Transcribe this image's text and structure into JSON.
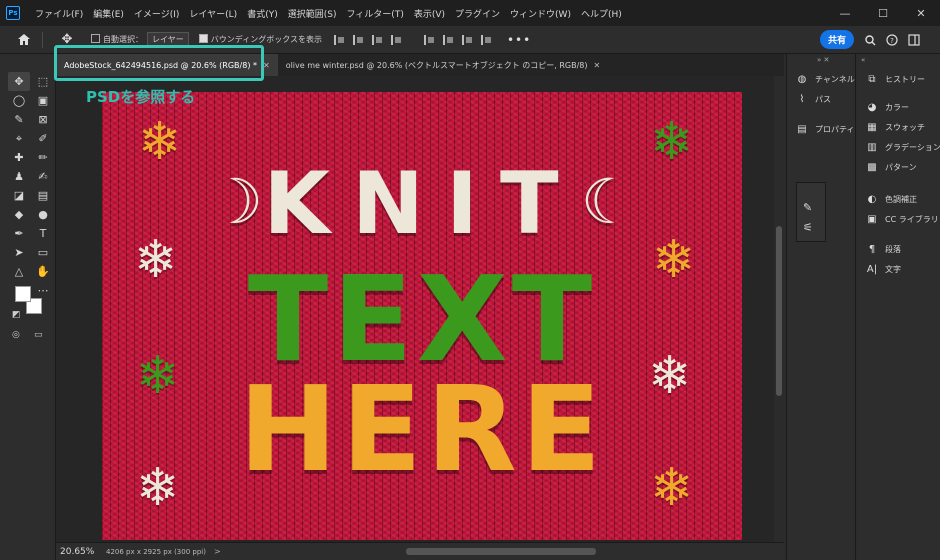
{
  "app": {
    "logo": "Ps"
  },
  "menu": {
    "items": [
      "ファイル(F)",
      "編集(E)",
      "イメージ(I)",
      "レイヤー(L)",
      "書式(Y)",
      "選択範囲(S)",
      "フィルター(T)",
      "表示(V)",
      "プラグイン",
      "ウィンドウ(W)",
      "ヘルプ(H)"
    ]
  },
  "window_controls": {
    "minimize": "—",
    "maximize": "☐",
    "close": "✕"
  },
  "options": {
    "auto_select": "自動選択：",
    "layer_dropdown": "レイヤー",
    "bounding_box": "バウンディングボックスを表示",
    "more": "•••",
    "share": "共有"
  },
  "tabs": [
    {
      "label": "AdobeStock_642494516.psd @ 20.6% (RGB/8) *",
      "close": "✕"
    },
    {
      "label": "olive me winter.psd @ 20.6% (ベクトルスマートオブジェクト のコピー, RGB/8)",
      "close": "✕"
    }
  ],
  "callout": "PSDを参照する",
  "canvas": {
    "line1": "KNIT",
    "line2": "TEXT",
    "line3": "HERE",
    "moon_left": "☽",
    "moon_right": "☾",
    "snowflake": "❄"
  },
  "status": {
    "zoom": "20.65%",
    "doc_info": "4206 px x 2925 px (300 ppi)",
    "arrow": ">"
  },
  "panels_left": {
    "channels": "チャンネル",
    "paths": "パス",
    "properties": "プロパティ",
    "collapse": "» ✕"
  },
  "panels_right": {
    "history": "ヒストリー",
    "color": "カラー",
    "swatches": "スウォッチ",
    "gradients": "グラデーション",
    "patterns": "パターン",
    "adjustments": "色調補正",
    "libraries": "CC ライブラリ",
    "paragraph": "段落",
    "character": "文字",
    "collapse": "«"
  },
  "colors": {
    "accent": "#1473e6",
    "highlight": "#3cc8b9",
    "knit_red": "#c5143a",
    "knit_cream": "#ece7d8",
    "knit_green": "#3b9a1e",
    "knit_gold": "#f0a92c"
  }
}
